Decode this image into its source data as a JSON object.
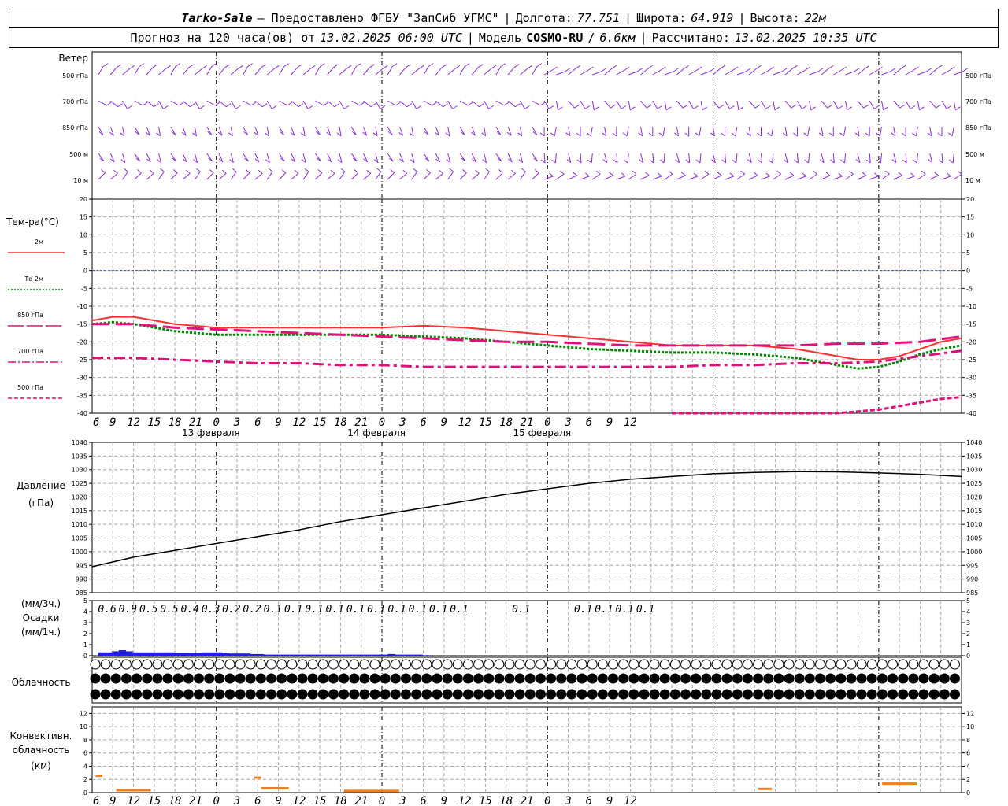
{
  "header": {
    "station": "Tarko-Sale",
    "provider": "— Предоставлено ФГБУ \"ЗапСиб УГМС\"",
    "lon_label": "Долгота:",
    "lon_value": "77.751",
    "lat_label": "Широта:",
    "lat_value": "64.919",
    "alt_label": "Высота:",
    "alt_value": "22м",
    "forecast_prefix": "Прогноз на 120 часа(ов) от",
    "forecast_start": "13.02.2025 06:00 UTC",
    "model_label": "Модель",
    "model_name": "COSMO-RU",
    "model_res": "6.6км",
    "calc_label": "Рассчитано:",
    "calc_time": "13.02.2025 10:35 UTC"
  },
  "wind_panel": {
    "title": "Ветер",
    "levels": [
      "500 гПа",
      "700 гПа",
      "850 гПа",
      "500 м",
      "10  м"
    ]
  },
  "temp_panel": {
    "title": "Тем-ра(°С)",
    "legend": [
      {
        "label": "2м",
        "color": "#ff3030",
        "dash": "solid"
      },
      {
        "label": "Td  2м",
        "color": "#008800",
        "dash": "dotted"
      },
      {
        "label": "850 гПа",
        "color": "#e0107a",
        "dash": "long"
      },
      {
        "label": "700 гПа",
        "color": "#e0107a",
        "dash": "dashdot"
      },
      {
        "label": "500 гПа",
        "color": "#e0107a",
        "dash": "short"
      }
    ]
  },
  "pressure_panel": {
    "title": "Давление",
    "unit": "(гПа)"
  },
  "precip_panel": {
    "unit_top": "(мм/3ч.)",
    "title": "Осадки",
    "unit_bottom": "(мм/1ч.)"
  },
  "cloud_panel": {
    "title": "Облачность"
  },
  "conv_panel": {
    "title_1": "Конвективн.",
    "title_2": "облачность",
    "unit": "(км)"
  },
  "time_axis": {
    "hour_labels": [
      "6",
      "9",
      "12",
      "15",
      "18",
      "21",
      "0",
      "3",
      "6",
      "9",
      "12",
      "15",
      "18",
      "21",
      "0",
      "3",
      "6",
      "9",
      "12",
      "15",
      "18",
      "21",
      "0",
      "3",
      "6",
      "9",
      "12"
    ],
    "day_labels": [
      "13 февраля",
      "14 февраля",
      "15 февраля"
    ]
  },
  "colors": {
    "wind": "#8a2be2",
    "t2m": "#ff3030",
    "td": "#008800",
    "upper": "#e0107a",
    "pressure": "#000000",
    "precip": "#2020e0",
    "conv": "#f08020",
    "zero_line": "#4040ff"
  },
  "chart_data": [
    {
      "type": "line",
      "title": "Тем-ра(°С)",
      "x_unit": "hours from 13.02.2025 06:00 UTC",
      "ylim": [
        -40,
        20
      ],
      "yticks": [
        20,
        15,
        10,
        5,
        0,
        -5,
        -10,
        -15,
        -20,
        -25,
        -30,
        -35,
        -40
      ],
      "grid": true,
      "series": [
        {
          "name": "2м",
          "x": [
            0,
            3,
            6,
            9,
            12,
            18,
            24,
            30,
            36,
            42,
            48,
            54,
            60,
            66,
            72,
            78,
            84,
            90,
            96,
            99,
            102,
            105,
            108,
            111,
            114,
            117,
            120,
            123,
            126
          ],
          "values": [
            -14,
            -13,
            -13,
            -14,
            -15,
            -16,
            -16,
            -16,
            -16,
            -16,
            -15.5,
            -16,
            -17,
            -18,
            -19,
            -20,
            -21,
            -21,
            -21,
            -21.5,
            -22,
            -23,
            -24,
            -25,
            -25,
            -24,
            -22,
            -20,
            -19
          ]
        },
        {
          "name": "Td  2м",
          "x": [
            0,
            3,
            6,
            9,
            12,
            18,
            24,
            30,
            36,
            42,
            48,
            54,
            60,
            66,
            72,
            78,
            84,
            90,
            96,
            99,
            102,
            105,
            108,
            111,
            114,
            117,
            120,
            123,
            126
          ],
          "values": [
            -15,
            -14.5,
            -15,
            -16,
            -17,
            -18,
            -18,
            -18,
            -18,
            -18,
            -18.5,
            -19,
            -20,
            -21,
            -22,
            -22.5,
            -23,
            -23,
            -23.5,
            -24,
            -24.5,
            -25.5,
            -26.5,
            -27.5,
            -27,
            -25.5,
            -23.5,
            -22,
            -21
          ]
        },
        {
          "name": "850 гПа",
          "x": [
            0,
            6,
            12,
            18,
            24,
            30,
            36,
            42,
            48,
            54,
            60,
            66,
            72,
            78,
            84,
            90,
            96,
            102,
            108,
            114,
            120,
            126
          ],
          "values": [
            -15,
            -15,
            -16,
            -16.5,
            -17,
            -17.5,
            -18,
            -18.5,
            -19,
            -19.5,
            -20,
            -20,
            -20.5,
            -21,
            -21,
            -21,
            -21,
            -21,
            -20.5,
            -20.5,
            -20,
            -18.5
          ]
        },
        {
          "name": "700 гПа",
          "x": [
            0,
            6,
            12,
            18,
            24,
            30,
            36,
            42,
            48,
            54,
            60,
            66,
            72,
            78,
            84,
            90,
            96,
            102,
            108,
            114,
            120,
            126
          ],
          "values": [
            -24.5,
            -24.5,
            -25,
            -25.5,
            -26,
            -26,
            -26.5,
            -26.5,
            -27,
            -27,
            -27,
            -27,
            -27,
            -27,
            -27,
            -26.5,
            -26.5,
            -26,
            -26,
            -25.5,
            -24,
            -22.5
          ]
        },
        {
          "name": "500 гПа",
          "x": [
            84,
            87,
            90,
            93,
            96,
            99,
            102,
            105,
            108,
            111,
            114,
            117,
            120,
            123,
            126
          ],
          "values": [
            -40,
            -40,
            -40,
            -40,
            -40,
            -40,
            -40,
            -40,
            -40,
            -39.5,
            -39,
            -38,
            -37,
            -36,
            -35.5
          ]
        }
      ]
    },
    {
      "type": "line",
      "title": "Давление",
      "ylabel": "(гПа)",
      "x_unit": "hours from 13.02.2025 06:00 UTC",
      "ylim": [
        985,
        1040
      ],
      "yticks": [
        1040,
        1035,
        1030,
        1025,
        1020,
        1015,
        1010,
        1005,
        1000,
        995,
        990,
        985
      ],
      "grid": true,
      "series": [
        {
          "name": "Давление",
          "x": [
            0,
            6,
            12,
            18,
            24,
            30,
            36,
            42,
            48,
            54,
            60,
            66,
            72,
            78,
            84,
            90,
            96,
            102,
            108,
            114,
            120,
            126
          ],
          "values": [
            994.5,
            998,
            1000.5,
            1003,
            1005.5,
            1008,
            1011,
            1013.5,
            1016,
            1018.5,
            1021,
            1023,
            1025,
            1026.5,
            1027.5,
            1028.5,
            1029,
            1029.3,
            1029.2,
            1028.8,
            1028.3,
            1027.5
          ]
        }
      ]
    },
    {
      "type": "bar",
      "title": "Осадки",
      "ylabel": "(мм/3ч.) / (мм/1ч.)",
      "x_unit": "hours from 13.02.2025 06:00 UTC",
      "ylim": [
        0,
        5
      ],
      "yticks": [
        5,
        4,
        3,
        2,
        1,
        0
      ],
      "labels_3h": [
        "0.6",
        "0.9",
        "0.5",
        "0.5",
        "0.4",
        "0.3",
        "0.2",
        "0.2",
        "0.1",
        "0.1",
        "0.1",
        "0.1",
        "0.1",
        "0.1",
        "0.1",
        "0.1",
        "0.1",
        "0.1",
        "",
        "",
        "0.1",
        "",
        "",
        "0.1",
        "0.1",
        "0.1",
        "0.1"
      ],
      "x": [
        1,
        2,
        3,
        4,
        5,
        6,
        7,
        8,
        9,
        10,
        11,
        12,
        13,
        14,
        15,
        16,
        17,
        18,
        19,
        20,
        21,
        22,
        23,
        24,
        25,
        26,
        27,
        28,
        29,
        30,
        31,
        32,
        33,
        34,
        35,
        36,
        37,
        38,
        39,
        40,
        41,
        42,
        43,
        44,
        45,
        46,
        47,
        48
      ],
      "values": [
        0.3,
        0.3,
        0.4,
        0.5,
        0.4,
        0.3,
        0.3,
        0.3,
        0.3,
        0.3,
        0.3,
        0.25,
        0.25,
        0.25,
        0.25,
        0.3,
        0.3,
        0.3,
        0.25,
        0.2,
        0.2,
        0.2,
        0.15,
        0.15,
        0.1,
        0.1,
        0.1,
        0.1,
        0.1,
        0.1,
        0.1,
        0.1,
        0.1,
        0.1,
        0.1,
        0.1,
        0.1,
        0.1,
        0.1,
        0.1,
        0.1,
        0.1,
        0.15,
        0.1,
        0.1,
        0.1,
        0.1,
        0.05
      ]
    },
    {
      "type": "bar",
      "title": "Конвективн. облачность",
      "ylabel": "(км)",
      "x_unit": "hours from 13.02.2025 06:00 UTC",
      "ylim": [
        0,
        13
      ],
      "yticks": [
        12,
        10,
        8,
        6,
        4,
        2,
        0
      ],
      "segments": [
        {
          "x0": 0.5,
          "x1": 1.5,
          "value": 2.5
        },
        {
          "x0": 3.5,
          "x1": 8.5,
          "value": 0.3
        },
        {
          "x0": 23.5,
          "x1": 24.5,
          "value": 2.2
        },
        {
          "x0": 24.5,
          "x1": 28.5,
          "value": 0.6
        },
        {
          "x0": 36.5,
          "x1": 44.5,
          "value": 0.2
        },
        {
          "x0": 96.5,
          "x1": 98.5,
          "value": 0.5
        },
        {
          "x0": 114.5,
          "x1": 119.5,
          "value": 1.3
        }
      ]
    }
  ]
}
